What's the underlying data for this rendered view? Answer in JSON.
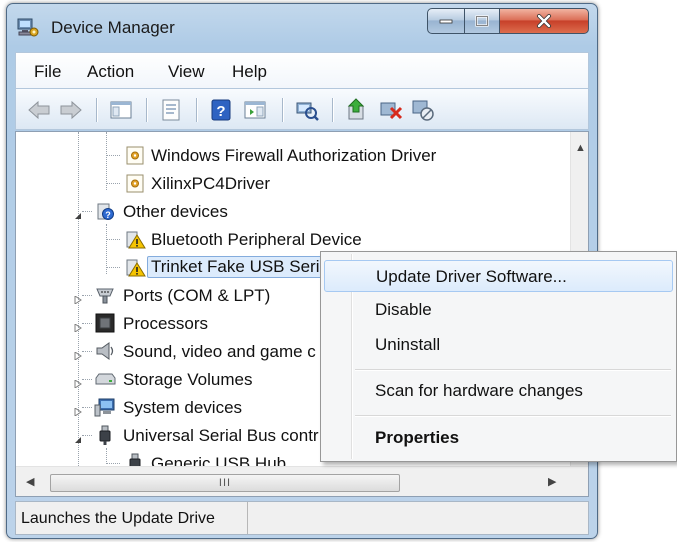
{
  "window": {
    "title": "Device Manager",
    "icons": {
      "app": "computer-management-icon",
      "minimize": "minimize-icon",
      "maximize": "maximize-icon",
      "close": "close-icon"
    }
  },
  "menu": [
    "File",
    "Action",
    "View",
    "Help"
  ],
  "toolbar": {
    "buttons": [
      "back-arrow-icon",
      "forward-arrow-icon",
      "show-hide-console-tree-icon",
      "properties-icon",
      "help-icon",
      "show-action-pane-icon",
      "scan-hardware-icon",
      "update-driver-icon",
      "uninstall-icon",
      "disable-icon"
    ]
  },
  "tree": {
    "items": [
      {
        "label": "Windows Firewall Authorization Driver",
        "icon": "driver-gear-icon"
      },
      {
        "label": "XilinxPC4Driver",
        "icon": "driver-gear-icon"
      },
      {
        "label": "Other devices",
        "icon": "unknown-device-icon",
        "expanded": true
      },
      {
        "label": "Bluetooth Peripheral Device",
        "icon": "warning-device-icon"
      },
      {
        "label": "Trinket Fake USB Seri",
        "icon": "warning-device-icon",
        "selected": true
      },
      {
        "label": "Ports (COM & LPT)",
        "icon": "port-icon"
      },
      {
        "label": "Processors",
        "icon": "processor-icon"
      },
      {
        "label": "Sound, video and game c",
        "icon": "speaker-icon"
      },
      {
        "label": "Storage Volumes",
        "icon": "drive-icon"
      },
      {
        "label": "System devices",
        "icon": "computer-icon"
      },
      {
        "label": "Universal Serial Bus contr",
        "icon": "usb-plug-icon",
        "expanded": true
      },
      {
        "label": "Generic USB Hub",
        "icon": "usb-plug-icon"
      }
    ]
  },
  "scrollbar": {
    "grip": "III"
  },
  "status": {
    "text": "Launches the Update Drive"
  },
  "context_menu": {
    "items": [
      {
        "label": "Update Driver Software...",
        "highlighted": true
      },
      {
        "label": "Disable"
      },
      {
        "label": "Uninstall"
      },
      {
        "label": "Scan for hardware changes"
      },
      {
        "label": "Properties",
        "bold": true
      }
    ]
  },
  "colors": {
    "selection": "#dcebfc",
    "selection_border": "#84acdd",
    "warning": "#f5c400",
    "close_button": "#c7402a"
  }
}
